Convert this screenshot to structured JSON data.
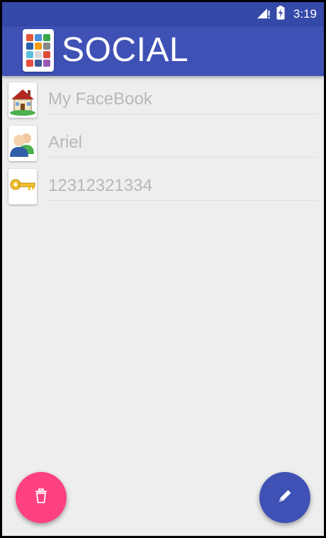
{
  "status_bar": {
    "time": "3:19",
    "icons": [
      "signal-icon",
      "battery-charging-icon"
    ]
  },
  "app_bar": {
    "title": "SOCIAL",
    "logo": "social-apps-logo"
  },
  "list": {
    "items": [
      {
        "label": "My FaceBook",
        "icon": "house-icon"
      },
      {
        "label": "Ariel",
        "icon": "users-icon"
      },
      {
        "label": "12312321334",
        "icon": "key-icon"
      }
    ]
  },
  "actions": {
    "delete_icon": "trash-icon",
    "edit_icon": "pencil-icon"
  },
  "colors": {
    "primary": "#3f51b5",
    "primary_dark": "#3549a8",
    "accent": "#ff4081",
    "background": "#eeeeee",
    "item_text": "#b8b8b8"
  }
}
